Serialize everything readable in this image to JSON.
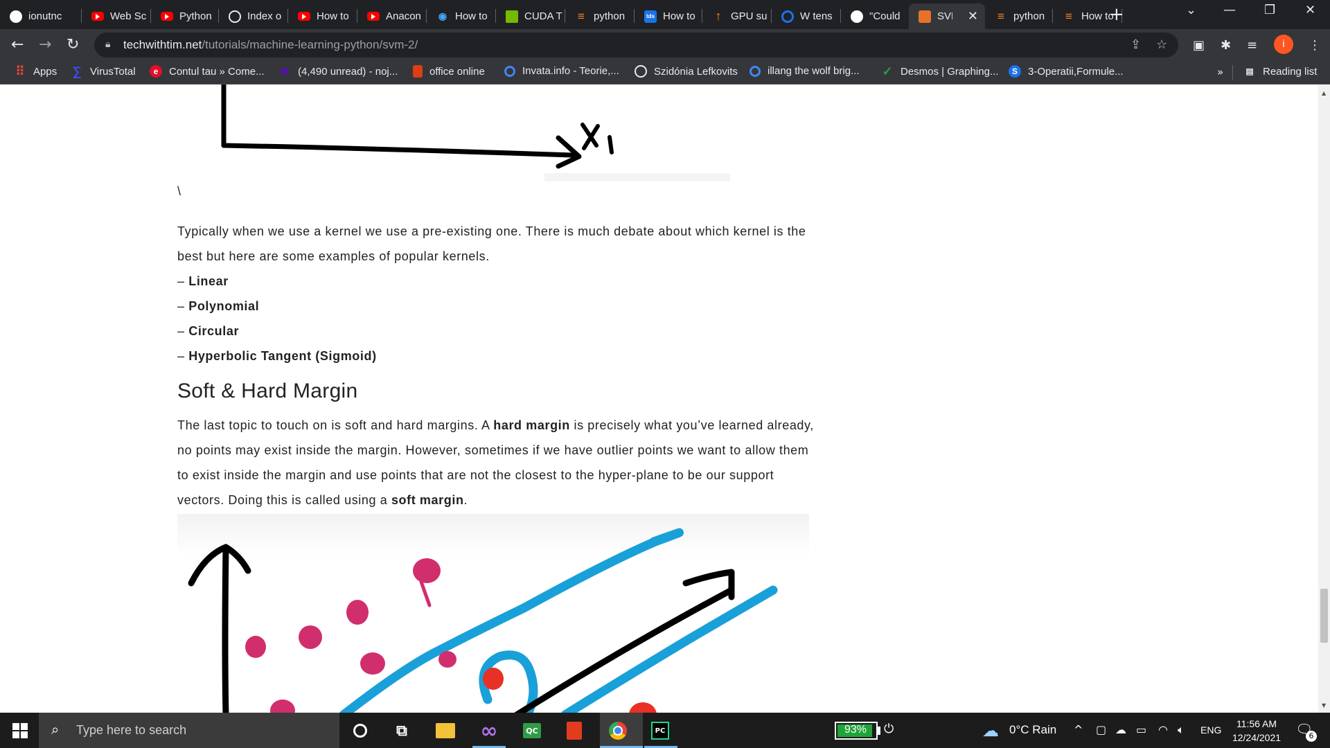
{
  "tabs": [
    {
      "title": "ionutnc",
      "icon": "github-icon"
    },
    {
      "title": "Web Sc",
      "icon": "youtube-icon"
    },
    {
      "title": "Python",
      "icon": "youtube-icon"
    },
    {
      "title": "Index o",
      "icon": "globe-icon"
    },
    {
      "title": "How to",
      "icon": "youtube-icon"
    },
    {
      "title": "Anacon",
      "icon": "youtube-icon"
    },
    {
      "title": "How to",
      "icon": "anaconda-icon"
    },
    {
      "title": "CUDA T",
      "icon": "nvidia-icon"
    },
    {
      "title": "python",
      "icon": "stackoverflow-icon"
    },
    {
      "title": "How to",
      "icon": "tds-icon"
    },
    {
      "title": "GPU su",
      "icon": "tensorflow-icon"
    },
    {
      "title": "W tens",
      "icon": "ring-icon"
    },
    {
      "title": "\"Could",
      "icon": "github-icon"
    },
    {
      "title": "SVM",
      "icon": "svm-icon",
      "active": true
    },
    {
      "title": "python",
      "icon": "stackoverflow-icon"
    },
    {
      "title": "How to",
      "icon": "stackoverflow-icon"
    }
  ],
  "address_bar": {
    "host": "techwithtim.net",
    "path": "/tutorials/machine-learning-python/svm-2/"
  },
  "bookmarks": [
    {
      "label": "Apps",
      "icon": "apps-grid-icon"
    },
    {
      "label": "VirusTotal",
      "icon": "virustotal-icon"
    },
    {
      "label": "Contul tau » Come...",
      "icon": "emag-icon"
    },
    {
      "label": "(4,490 unread) - noj...",
      "icon": "yahoo-mail-icon"
    },
    {
      "label": "office online",
      "icon": "office-icon"
    },
    {
      "label": "Invata.info - Teorie,...",
      "icon": "invata-icon"
    },
    {
      "label": "Szidónia Lefkovits",
      "icon": "globe-icon"
    },
    {
      "label": "illang the wolf brig...",
      "icon": "google-icon"
    },
    {
      "label": "Desmos | Graphing...",
      "icon": "desmos-icon"
    },
    {
      "label": "3-Operatii,Formule...",
      "icon": "s3-icon"
    }
  ],
  "bookmarks_more": "»",
  "reading_list": "Reading list",
  "profile_initial": "i",
  "article": {
    "backslash": "\\",
    "intro": "Typically when we use a kernel we use a pre-existing one. There is much debate about which kernel is the best but here are some examples of popular kernels.",
    "kernels": [
      {
        "dash": "– ",
        "name": "Linear"
      },
      {
        "dash": "– ",
        "name": "Polynomial"
      },
      {
        "dash": "– ",
        "name": "Circular"
      },
      {
        "dash": "– ",
        "name": "Hyperbolic Tangent (Sigmoid)"
      }
    ],
    "heading": "Soft & Hard Margin",
    "paragraph": {
      "t1": "The last topic to touch on is soft and hard margins. A ",
      "b1": "hard margin",
      "t2": " is precisely what you’ve learned already, no points may exist inside the margin. However, sometimes if we have outlier points we want to allow them to exist inside the margin and use points that are not the closest to the hyper-plane to be our support vectors. Doing this is called using a ",
      "b2": "soft margin",
      "t3": "."
    },
    "figure_top_axis_label": "X1"
  },
  "colors": {
    "margin_line": "#1aa0d8",
    "class_a": "#d12e6e",
    "class_b": "#e83024",
    "axis": "#000000"
  },
  "taskbar": {
    "search_placeholder": "Type here to search",
    "battery_percent": 93,
    "battery_label": "93%",
    "weather": "0°C  Rain",
    "language": "ENG",
    "time": "11:56 AM",
    "date": "12/24/2021",
    "notification_count": "6"
  }
}
